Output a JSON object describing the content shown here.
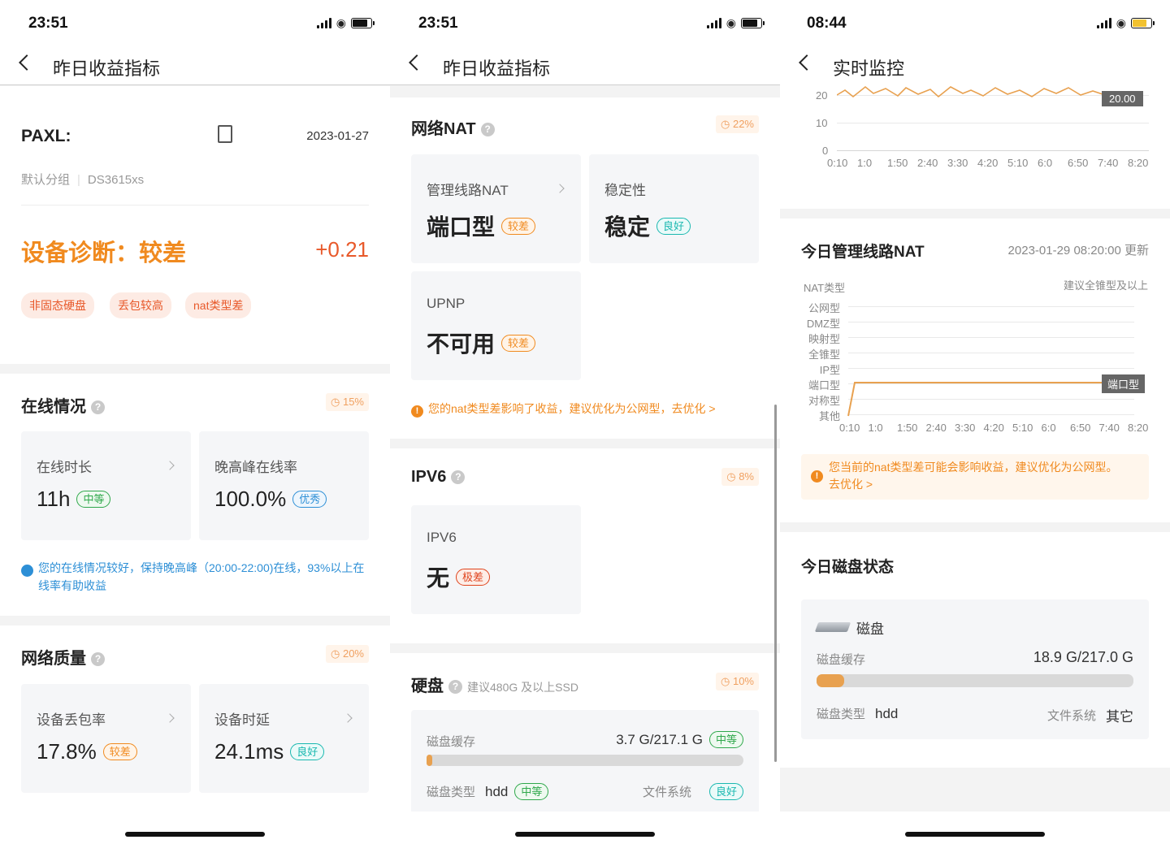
{
  "p1": {
    "time": "23:51",
    "title": "昨日收益指标",
    "device": "PAXL:",
    "date": "2023-01-27",
    "group": "默认分组",
    "model": "DS3615xs",
    "diag": "设备诊断：较差",
    "delta": "+0.21",
    "tags": [
      "非固态硬盘",
      "丢包较高",
      "nat类型差"
    ],
    "online": {
      "title": "在线情况",
      "pct": "15%",
      "t1": {
        "label": "在线时长",
        "value": "11h",
        "badge": "中等"
      },
      "t2": {
        "label": "晚高峰在线率",
        "value": "100.0%",
        "badge": "优秀"
      },
      "note": "您的在线情况较好，保持晚高峰（20:00-22:00)在线，93%以上在线率有助收益"
    },
    "net": {
      "title": "网络质量",
      "pct": "20%",
      "t1": {
        "label": "设备丢包率",
        "value": "17.8%",
        "badge": "较差"
      },
      "t2": {
        "label": "设备时延",
        "value": "24.1ms",
        "badge": "良好"
      }
    }
  },
  "p2": {
    "time": "23:51",
    "title": "昨日收益指标",
    "nat": {
      "title": "网络NAT",
      "pct": "22%",
      "t1": {
        "label": "管理线路NAT",
        "value": "端口型",
        "badge": "较差"
      },
      "t2": {
        "label": "稳定性",
        "value": "稳定",
        "badge": "良好"
      },
      "t3": {
        "label": "UPNP",
        "value": "不可用",
        "badge": "较差"
      },
      "note": "您的nat类型差影响了收益，建议优化为公网型，去优化 >"
    },
    "ipv6": {
      "title": "IPV6",
      "pct": "8%",
      "t1": {
        "label": "IPV6",
        "value": "无",
        "badge": "极差"
      }
    },
    "disk": {
      "title": "硬盘",
      "hint": "建议480G 及以上SSD",
      "pct": "10%",
      "cache_label": "磁盘缓存",
      "cache_value": "3.7 G/217.1 G",
      "cache_badge": "中等",
      "cache_fraction": 0.017,
      "type_label": "磁盘类型",
      "type_value": "hdd",
      "type_badge": "中等",
      "fs_label": "文件系统",
      "fs_badge": "良好"
    }
  },
  "p3": {
    "time": "08:44",
    "title": "实时监控",
    "top_chart": {
      "y_ticks": [
        "20",
        "10",
        "0"
      ],
      "x_ticks": [
        "0:10",
        "1:0",
        "1:50",
        "2:40",
        "3:30",
        "4:20",
        "5:10",
        "6:0",
        "6:50",
        "7:40",
        "8:20"
      ],
      "tooltip": "20.00"
    },
    "nat": {
      "title": "今日管理线路NAT",
      "updated": "2023-01-29 08:20:00 更新",
      "ylabel": "NAT类型",
      "hint": "建议全锥型及以上",
      "levels": [
        "公网型",
        "DMZ型",
        "映射型",
        "全锥型",
        "IP型",
        "端口型",
        "对称型",
        "其他"
      ],
      "x_ticks": [
        "0:10",
        "1:0",
        "1:50",
        "2:40",
        "3:30",
        "4:20",
        "5:10",
        "6:0",
        "6:50",
        "7:40",
        "8:20"
      ],
      "tooltip": "端口型",
      "note": "您当前的nat类型差可能会影响收益，建议优化为公网型。去优化 >"
    },
    "disk": {
      "title": "今日磁盘状态",
      "name": "磁盘",
      "cache_label": "磁盘缓存",
      "cache_value": "18.9 G/217.0 G",
      "cache_fraction": 0.087,
      "type_label": "磁盘类型",
      "type_value": "hdd",
      "fs_label": "文件系统",
      "fs_value": "其它"
    }
  },
  "colors": {
    "orange": "#f08a1f",
    "blue": "#2d8fd6",
    "green": "#2fa84b",
    "chart": "#e8a150"
  }
}
